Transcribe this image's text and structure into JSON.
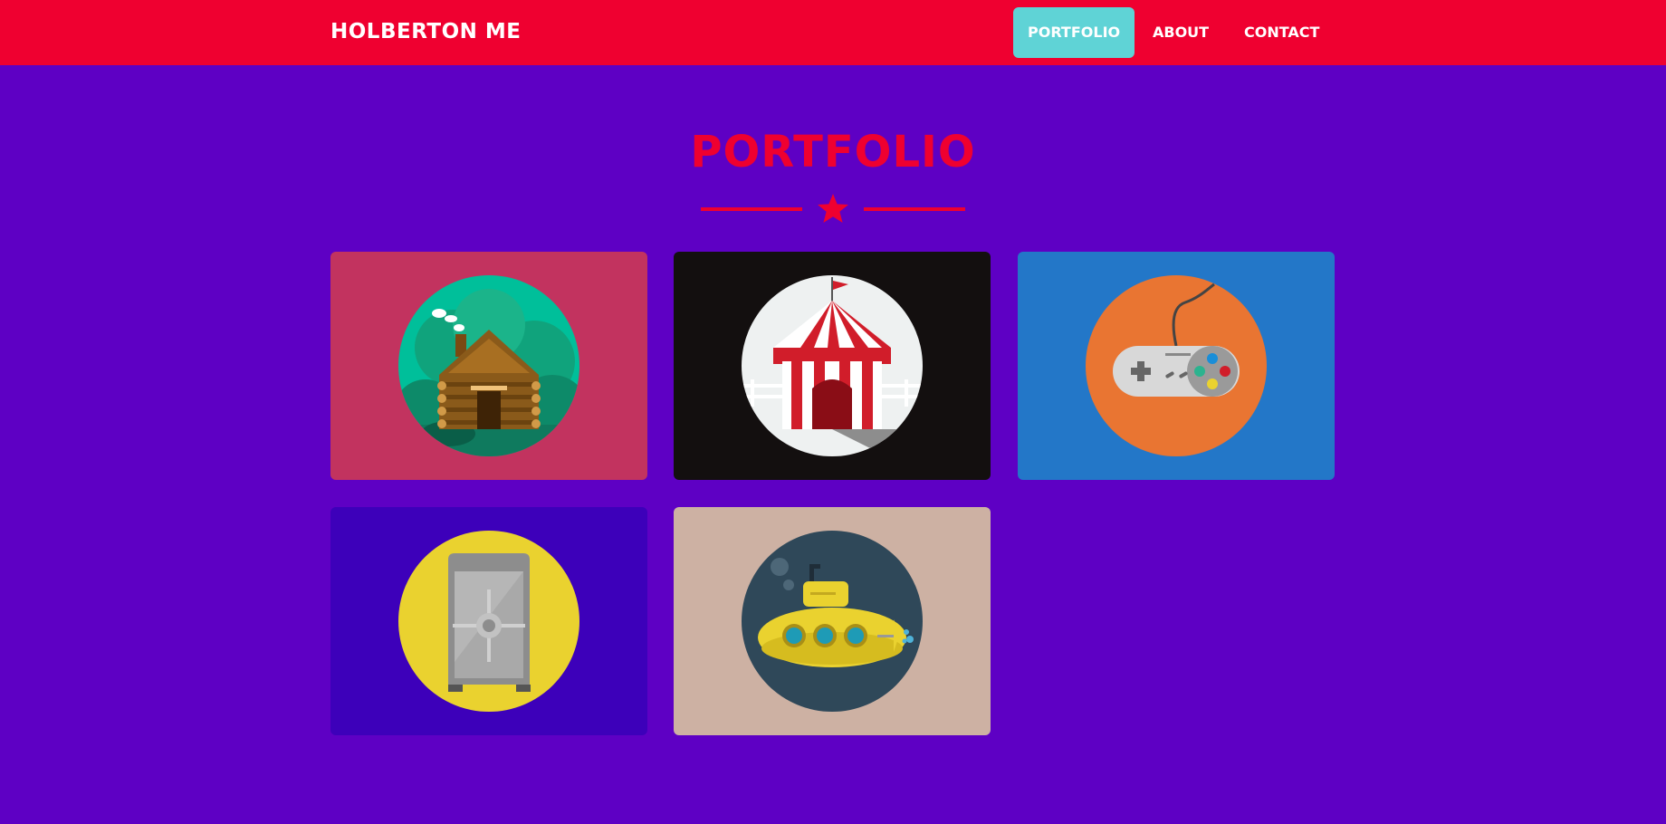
{
  "navbar": {
    "brand": "HOLBERTON ME",
    "items": [
      {
        "label": "PORTFOLIO",
        "active": true
      },
      {
        "label": "ABOUT",
        "active": false
      },
      {
        "label": "CONTACT",
        "active": false
      }
    ]
  },
  "section": {
    "title": "PORTFOLIO",
    "divider_icon": "star-icon"
  },
  "portfolio": {
    "items": [
      {
        "icon": "cabin-icon",
        "background": "#c2335f",
        "circle": "#00bf9a"
      },
      {
        "icon": "circus-tent-icon",
        "background": "#130f0f",
        "circle": "#eef1f1"
      },
      {
        "icon": "game-controller-icon",
        "background": "#2377c8",
        "circle": "#e97532"
      },
      {
        "icon": "safe-icon",
        "background": "#3d00ba",
        "circle": "#ead22f"
      },
      {
        "icon": "submarine-icon",
        "background": "#cdb1a3",
        "circle": "#2f4859"
      }
    ]
  },
  "colors": {
    "page_background": "#5e00c4",
    "navbar": "#ef0030",
    "accent": "#ef0030",
    "active_nav": "#5fd3d6"
  }
}
